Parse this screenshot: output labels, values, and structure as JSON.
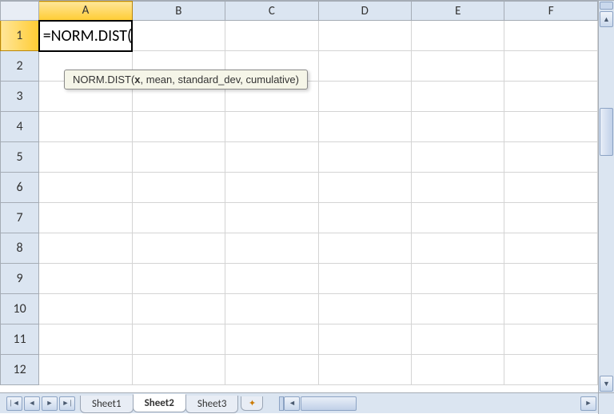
{
  "columns": [
    "A",
    "B",
    "C",
    "D",
    "E",
    "F"
  ],
  "selected_column_index": 0,
  "rows": [
    1,
    2,
    3,
    4,
    5,
    6,
    7,
    8,
    9,
    10,
    11,
    12
  ],
  "selected_row_index": 0,
  "active_cell": {
    "row": 1,
    "col": "A",
    "content": "=NORM.DIST("
  },
  "tooltip": {
    "func_name": "NORM.DIST(",
    "current_arg": "x",
    "rest_args": ", mean, standard_dev, cumulative)"
  },
  "sheets": {
    "tabs": [
      "Sheet1",
      "Sheet2",
      "Sheet3"
    ],
    "active_index": 1
  },
  "nav_icons": {
    "first": "|◄",
    "prev": "◄",
    "next": "►",
    "last": "►|",
    "up": "▲",
    "down": "▼",
    "left": "◄",
    "right": "►",
    "new_sheet": "✦"
  }
}
